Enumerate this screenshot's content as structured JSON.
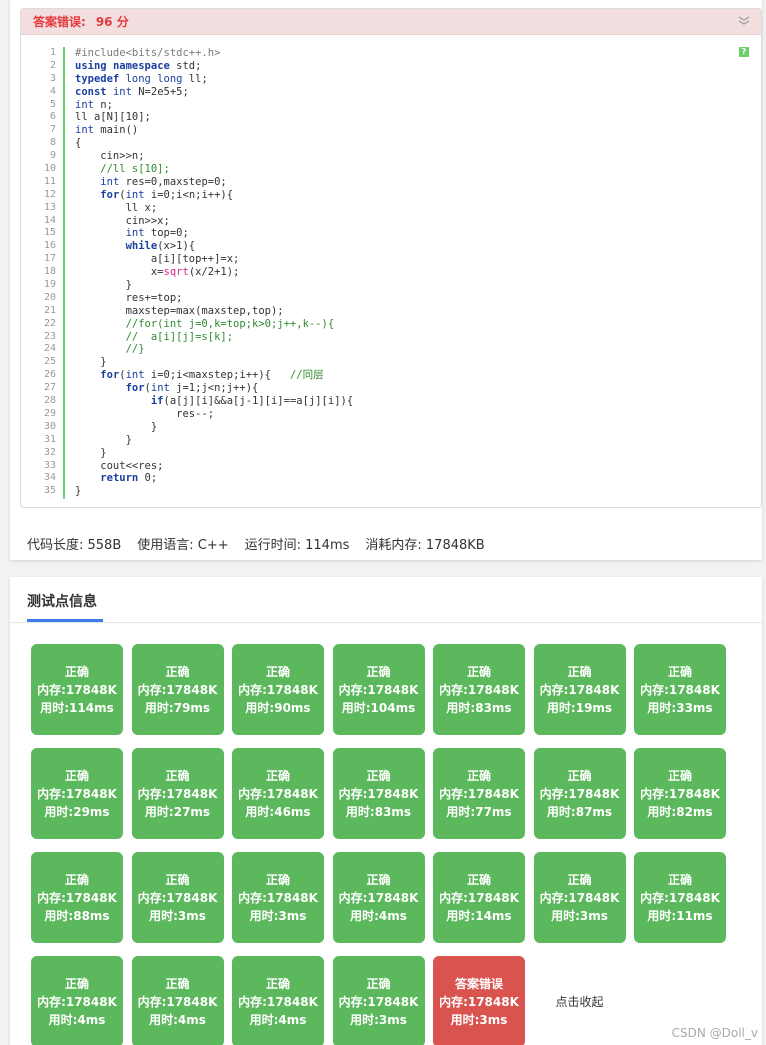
{
  "submission": {
    "status_label": "答案错误:",
    "score": "96 分"
  },
  "code": {
    "lines": [
      [
        [
          "pp",
          "#include<bits/stdc++.h>"
        ]
      ],
      [
        [
          "kw",
          "using"
        ],
        [
          "",
          " "
        ],
        [
          "kw",
          "namespace"
        ],
        [
          "",
          " std;"
        ]
      ],
      [
        [
          "kw",
          "typedef"
        ],
        [
          "",
          " "
        ],
        [
          "ty",
          "long long"
        ],
        [
          "",
          " ll;"
        ]
      ],
      [
        [
          "kw",
          "const"
        ],
        [
          "",
          " "
        ],
        [
          "ty",
          "int"
        ],
        [
          "",
          " N=2e5+5;"
        ]
      ],
      [
        [
          "ty",
          "int"
        ],
        [
          "",
          " n;"
        ]
      ],
      [
        [
          "",
          "ll a[N][10];"
        ]
      ],
      [
        [
          "ty",
          "int"
        ],
        [
          "",
          " main()"
        ]
      ],
      [
        [
          "",
          "{"
        ]
      ],
      [
        [
          "",
          "    cin>>n;"
        ]
      ],
      [
        [
          "cm",
          "    //ll s[10];"
        ]
      ],
      [
        [
          "",
          "    "
        ],
        [
          "ty",
          "int"
        ],
        [
          "",
          " res=0,maxstep=0;"
        ]
      ],
      [
        [
          "",
          "    "
        ],
        [
          "kw",
          "for"
        ],
        [
          "",
          "("
        ],
        [
          "ty",
          "int"
        ],
        [
          "",
          " i=0;i<n;i++){"
        ]
      ],
      [
        [
          "",
          "        ll x;"
        ]
      ],
      [
        [
          "",
          "        cin>>x;"
        ]
      ],
      [
        [
          "",
          "        "
        ],
        [
          "ty",
          "int"
        ],
        [
          "",
          " top=0;"
        ]
      ],
      [
        [
          "",
          "        "
        ],
        [
          "kw",
          "while"
        ],
        [
          "",
          "(x>1){"
        ]
      ],
      [
        [
          "",
          "            a[i][top++]=x;"
        ]
      ],
      [
        [
          "",
          "            x="
        ],
        [
          "fn",
          "sqrt"
        ],
        [
          "",
          "(x/2+1);"
        ]
      ],
      [
        [
          "",
          "        }"
        ]
      ],
      [
        [
          "",
          "        res+=top;"
        ]
      ],
      [
        [
          "",
          "        maxstep=max(maxstep,top);"
        ]
      ],
      [
        [
          "cm",
          "        //for(int j=0,k=top;k>0;j++,k--){"
        ]
      ],
      [
        [
          "cm",
          "        //  a[i][j]=s[k];"
        ]
      ],
      [
        [
          "cm",
          "        //}"
        ]
      ],
      [
        [
          "",
          "    }"
        ]
      ],
      [
        [
          "",
          "    "
        ],
        [
          "kw",
          "for"
        ],
        [
          "",
          "("
        ],
        [
          "ty",
          "int"
        ],
        [
          "",
          " i=0;i<maxstep;i++){   "
        ],
        [
          "cm",
          "//同层"
        ]
      ],
      [
        [
          "",
          "        "
        ],
        [
          "kw",
          "for"
        ],
        [
          "",
          "("
        ],
        [
          "ty",
          "int"
        ],
        [
          "",
          " j=1;j<n;j++){"
        ]
      ],
      [
        [
          "",
          "            "
        ],
        [
          "kw",
          "if"
        ],
        [
          "",
          "(a[j][i]&&a[j-1][i]==a[j][i]){"
        ]
      ],
      [
        [
          "",
          "                res--;"
        ]
      ],
      [
        [
          "",
          "            }"
        ]
      ],
      [
        [
          "",
          "        }"
        ]
      ],
      [
        [
          "",
          "    }"
        ]
      ],
      [
        [
          "",
          "    cout<<res;"
        ]
      ],
      [
        [
          "",
          "    "
        ],
        [
          "kw",
          "return"
        ],
        [
          "",
          " 0;"
        ]
      ],
      [
        [
          "",
          "}"
        ]
      ]
    ]
  },
  "meta": {
    "code_length": "代码长度: 558B",
    "language": "使用语言: C++",
    "run_time": "运行时间: 114ms",
    "memory": "消耗内存: 17848KB"
  },
  "tests": {
    "tab_label": "测试点信息",
    "collapse_label": "点击收起",
    "cases": [
      {
        "status": "正确",
        "memory": "内存:17848K",
        "time": "用时:114ms",
        "ok": true
      },
      {
        "status": "正确",
        "memory": "内存:17848K",
        "time": "用时:79ms",
        "ok": true
      },
      {
        "status": "正确",
        "memory": "内存:17848K",
        "time": "用时:90ms",
        "ok": true
      },
      {
        "status": "正确",
        "memory": "内存:17848K",
        "time": "用时:104ms",
        "ok": true
      },
      {
        "status": "正确",
        "memory": "内存:17848K",
        "time": "用时:83ms",
        "ok": true
      },
      {
        "status": "正确",
        "memory": "内存:17848K",
        "time": "用时:19ms",
        "ok": true
      },
      {
        "status": "正确",
        "memory": "内存:17848K",
        "time": "用时:33ms",
        "ok": true
      },
      {
        "status": "正确",
        "memory": "内存:17848K",
        "time": "用时:29ms",
        "ok": true
      },
      {
        "status": "正确",
        "memory": "内存:17848K",
        "time": "用时:27ms",
        "ok": true
      },
      {
        "status": "正确",
        "memory": "内存:17848K",
        "time": "用时:46ms",
        "ok": true
      },
      {
        "status": "正确",
        "memory": "内存:17848K",
        "time": "用时:83ms",
        "ok": true
      },
      {
        "status": "正确",
        "memory": "内存:17848K",
        "time": "用时:77ms",
        "ok": true
      },
      {
        "status": "正确",
        "memory": "内存:17848K",
        "time": "用时:87ms",
        "ok": true
      },
      {
        "status": "正确",
        "memory": "内存:17848K",
        "time": "用时:82ms",
        "ok": true
      },
      {
        "status": "正确",
        "memory": "内存:17848K",
        "time": "用时:88ms",
        "ok": true
      },
      {
        "status": "正确",
        "memory": "内存:17848K",
        "time": "用时:3ms",
        "ok": true
      },
      {
        "status": "正确",
        "memory": "内存:17848K",
        "time": "用时:3ms",
        "ok": true
      },
      {
        "status": "正确",
        "memory": "内存:17848K",
        "time": "用时:4ms",
        "ok": true
      },
      {
        "status": "正确",
        "memory": "内存:17848K",
        "time": "用时:14ms",
        "ok": true
      },
      {
        "status": "正确",
        "memory": "内存:17848K",
        "time": "用时:3ms",
        "ok": true
      },
      {
        "status": "正确",
        "memory": "内存:17848K",
        "time": "用时:11ms",
        "ok": true
      },
      {
        "status": "正确",
        "memory": "内存:17848K",
        "time": "用时:4ms",
        "ok": true
      },
      {
        "status": "正确",
        "memory": "内存:17848K",
        "time": "用时:4ms",
        "ok": true
      },
      {
        "status": "正确",
        "memory": "内存:17848K",
        "time": "用时:4ms",
        "ok": true
      },
      {
        "status": "正确",
        "memory": "内存:17848K",
        "time": "用时:3ms",
        "ok": true
      },
      {
        "status": "答案错误",
        "memory": "内存:17848K",
        "time": "用时:3ms",
        "ok": false
      }
    ]
  },
  "watermark": "CSDN @Doll_v",
  "colors": {
    "pass": "#5cb85c",
    "fail": "#d9534f",
    "accent": "#3e7be8",
    "error_header": "#f2dede"
  }
}
